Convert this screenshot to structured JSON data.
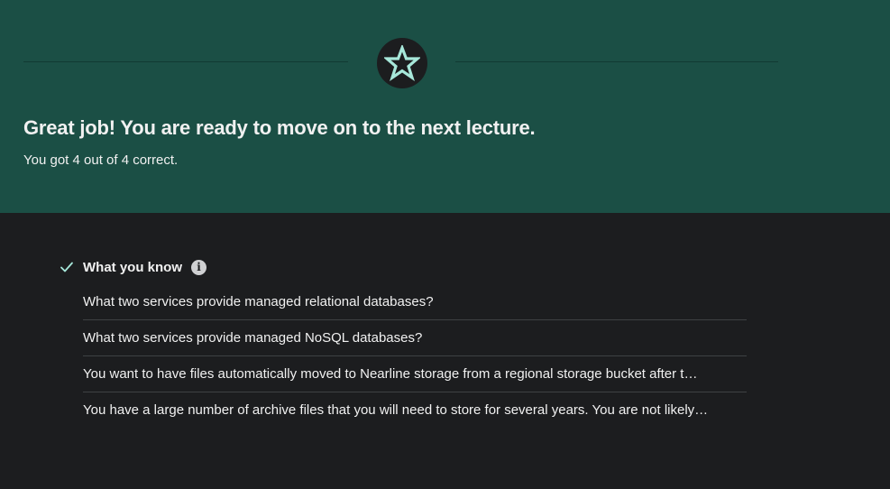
{
  "result": {
    "headline": "Great job! You are ready to move on to the next lecture.",
    "score_text": "You got 4 out of 4 correct."
  },
  "what_you_know": {
    "title": "What you know",
    "info_glyph": "i",
    "questions": [
      "What two services provide managed relational databases?",
      "What two services provide managed NoSQL databases?",
      "You want to have files automatically moved to Nearline storage from a regional storage bucket after t…",
      "You have a large number of archive files that you will need to store for several years. You are not likely…"
    ]
  },
  "colors": {
    "banner_bg": "#1b4f45",
    "page_bg": "#1c1d1f",
    "accent": "#a7e8da",
    "text": "#f1f1f1"
  },
  "icons": {
    "badge": "star-icon",
    "status": "check-icon",
    "info": "info-icon"
  }
}
